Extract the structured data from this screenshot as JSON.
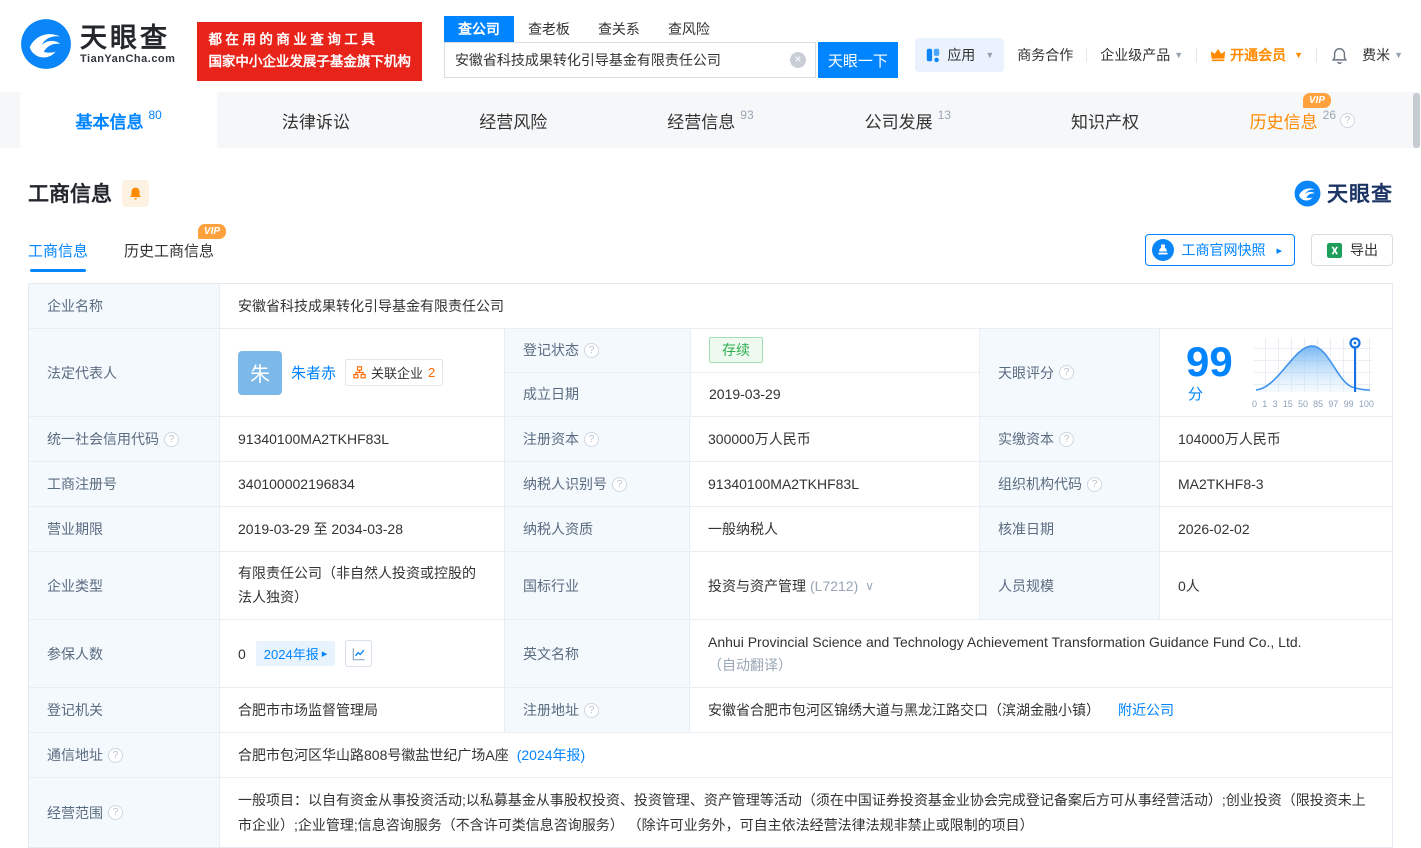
{
  "badges": {
    "vip": "VIP"
  },
  "header": {
    "logo": {
      "brand": "天眼查",
      "domain": "TianYanCha.com"
    },
    "promo": {
      "line1": "都在用的商业查询工具",
      "line2": "国家中小企业发展子基金旗下机构"
    },
    "search": {
      "tabs": [
        {
          "label": "查公司",
          "active": true
        },
        {
          "label": "查老板",
          "active": false
        },
        {
          "label": "查关系",
          "active": false
        },
        {
          "label": "查风险",
          "active": false
        }
      ],
      "value": "安徽省科技成果转化引导基金有限责任公司",
      "button": "天眼一下"
    },
    "nav": {
      "apps": "应用",
      "coop": "商务合作",
      "enterprise": "企业级产品",
      "vip": "开通会员",
      "user": "费米"
    }
  },
  "main_tabs": [
    {
      "label": "基本信息",
      "count": "80",
      "active": true
    },
    {
      "label": "法律诉讼",
      "count": ""
    },
    {
      "label": "经营风险",
      "count": ""
    },
    {
      "label": "经营信息",
      "count": "93"
    },
    {
      "label": "公司发展",
      "count": "13"
    },
    {
      "label": "知识产权",
      "count": ""
    },
    {
      "label": "历史信息",
      "count": "26",
      "vip": true
    }
  ],
  "section": {
    "title": "工商信息",
    "watermark": "天眼查",
    "subtabs": [
      {
        "label": "工商信息",
        "active": true
      },
      {
        "label": "历史工商信息",
        "vip": true
      }
    ],
    "snapshot_button": "工商官网快照",
    "export_button": "导出"
  },
  "t": {
    "name_l": "企业名称",
    "name_v": "安徽省科技成果转化引导基金有限责任公司",
    "rep_l": "法定代表人",
    "rep_avatar": "朱",
    "rep_name": "朱者赤",
    "rep_rel": "关联企业",
    "rep_rel_n": "2",
    "status_l": "登记状态",
    "status_v": "存续",
    "est_l": "成立日期",
    "est_v": "2019-03-29",
    "score_l": "天眼评分",
    "score_v": "99",
    "score_u": "分",
    "score_axis": [
      "0",
      "1",
      "3",
      "15",
      "50",
      "85",
      "97",
      "99",
      "100"
    ],
    "credit_l": "统一社会信用代码",
    "credit_v": "91340100MA2TKHF83L",
    "regcap_l": "注册资本",
    "regcap_v": "300000万人民币",
    "paidcap_l": "实缴资本",
    "paidcap_v": "104000万人民币",
    "regno_l": "工商注册号",
    "regno_v": "340100002196834",
    "taxid_l": "纳税人识别号",
    "taxid_v": "91340100MA2TKHF83L",
    "orgcode_l": "组织机构代码",
    "orgcode_v": "MA2TKHF8-3",
    "term_l": "营业期限",
    "term_v": "2019-03-29 至 2034-03-28",
    "taxq_l": "纳税人资质",
    "taxq_v": "一般纳税人",
    "appr_l": "核准日期",
    "appr_v": "2026-02-02",
    "type_l": "企业类型",
    "type_v": "有限责任公司（非自然人投资或控股的法人独资）",
    "ind_l": "国标行业",
    "ind_v": "投资与资产管理",
    "ind_code": "(L7212)",
    "staff_l": "人员规模",
    "staff_v": "0人",
    "insured_l": "参保人数",
    "insured_v": "0",
    "insured_badge": "2024年报",
    "en_l": "英文名称",
    "en_v": "Anhui Provincial Science and Technology Achievement Transformation Guidance Fund Co., Ltd.",
    "en_note": "（自动翻译）",
    "auth_l": "登记机关",
    "auth_v": "合肥市市场监督管理局",
    "addr_l": "注册地址",
    "addr_v": "安徽省合肥市包河区锦绣大道与黑龙江路交口（滨湖金融小镇）",
    "addr_link": "附近公司",
    "mail_l": "通信地址",
    "mail_v": "合肥市包河区华山路808号徽盐世纪广场A座",
    "mail_link": "(2024年报)",
    "scope_l": "经营范围",
    "scope_v": "一般项目：以自有资金从事投资活动;以私募基金从事股权投资、投资管理、资产管理等活动（须在中国证券投资基金业协会完成登记备案后方可从事经营活动）;创业投资（限投资未上市企业）;企业管理;信息咨询服务（不含许可类信息咨询服务） （除许可业务外，可自主依法经营法律法规非禁止或限制的项目）"
  }
}
